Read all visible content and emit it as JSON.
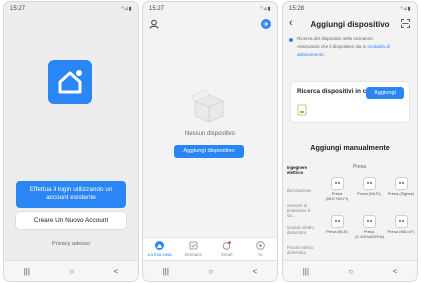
{
  "phone1": {
    "status": {
      "time": "15:27",
      "icons": "⁰⊿▮"
    },
    "login_button": "Effettua il login utilizzando un account esistente",
    "create_button": "Creare Un Nuovo Account",
    "privacy_link": "Privacy adesso",
    "nav": {
      "recent": "|||",
      "home": "○",
      "back": "<"
    },
    "colors": {
      "brand": "#2a86f5"
    }
  },
  "phone2": {
    "status": {
      "time": "15:27",
      "icons": "⁰⊿▮"
    },
    "empty_text": "Nessun dispositivo",
    "add_button": "Aggiungi dispositivo",
    "tabs": [
      {
        "label": "La mia casa",
        "icon": "home-icon"
      },
      {
        "label": "Scenario",
        "icon": "scenario-icon"
      },
      {
        "label": "Smart",
        "icon": "smart-icon"
      },
      {
        "label": "Io",
        "icon": "profile-icon"
      }
    ],
    "nav": {
      "recent": "|||",
      "home": "○",
      "back": "<"
    }
  },
  "phone3": {
    "status": {
      "time": "15:28",
      "icons": "⁰⊿▮"
    },
    "title": "Aggiungi dispositivo",
    "notice": {
      "line1": "Ricerca dei dispositivi nelle vicinanze.",
      "line2": "Assicurarsi che il dispositivo sia in",
      "link": "modalità di",
      "line3": "abbinamento."
    },
    "search_card": {
      "title": "Ricerca dispositivi in c...",
      "button": "Aggiungi"
    },
    "manual_title": "Aggiungi manualmente",
    "categories": [
      "Ingegnere elettrico",
      "Illuminazione",
      "Sensore di protezione d sic...",
      "Grande elettro domestico",
      "Piccolo elettro domestico"
    ],
    "group_label": "Presa",
    "devices": [
      {
        "label": "Presa (BLE+Wi-Fi)"
      },
      {
        "label": "Presa (Wi-Fi)"
      },
      {
        "label": "Presa (Zigbee)"
      },
      {
        "label": "Presa (BLE)"
      },
      {
        "label": "Presa (2.4GHz&5GHz)"
      },
      {
        "label": "Presa (NB-IoT)"
      }
    ],
    "nav": {
      "recent": "|||",
      "home": "○",
      "back": "<"
    }
  }
}
